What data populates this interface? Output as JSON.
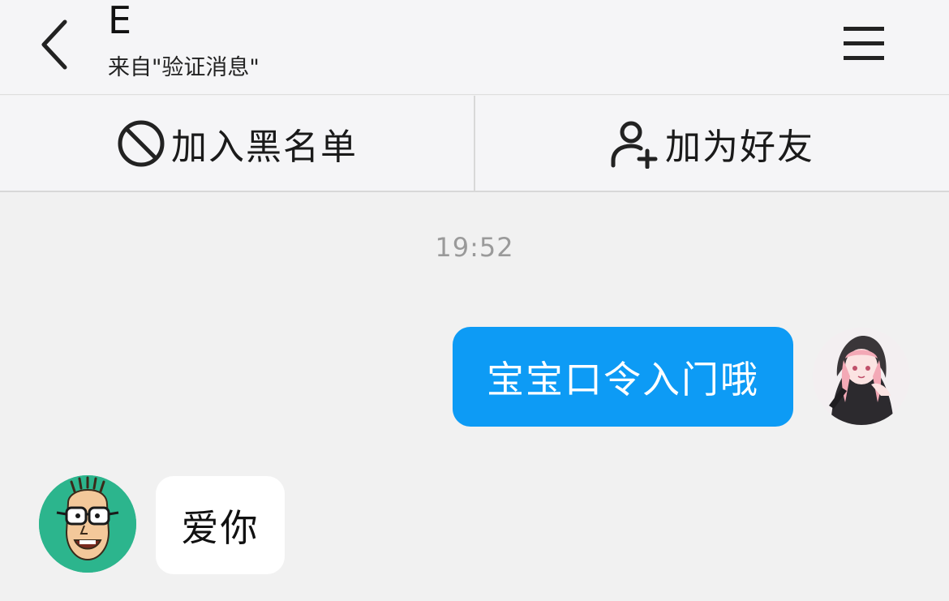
{
  "header": {
    "title": "E",
    "subtitle": "来自\"验证消息\"",
    "back_icon": "chevron-left-icon",
    "menu_icon": "hamburger-menu-icon"
  },
  "actions": {
    "block": {
      "label": "加入黑名单",
      "icon": "block-icon"
    },
    "add_friend": {
      "label": "加为好友",
      "icon": "add-user-icon"
    }
  },
  "chat": {
    "timestamp": "19:52",
    "messages": [
      {
        "direction": "outgoing",
        "text": "宝宝口令入门哦",
        "color": "#0d9bf5"
      },
      {
        "direction": "incoming",
        "text": "爱你",
        "color": "#ffffff"
      }
    ]
  },
  "colors": {
    "accent": "#0d9bf5",
    "background": "#f1f1f1",
    "bar": "#f5f5f7",
    "timestamp": "#9a9a9a"
  }
}
